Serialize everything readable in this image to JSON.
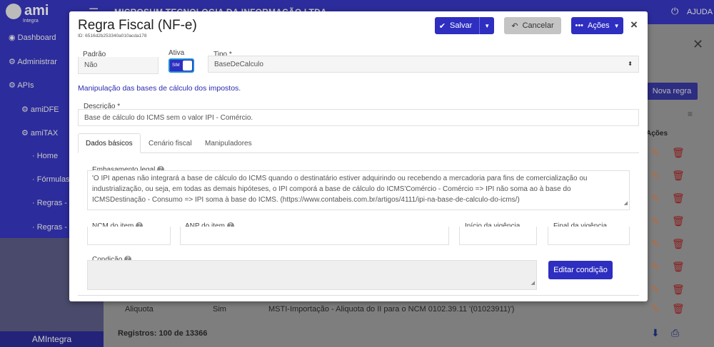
{
  "app": {
    "company": "MICROSUM TECNOLOGIA DA INFORMAÇÃO LTDA",
    "logo_text": "ami",
    "logo_sub": "Integra",
    "help_label": "AJUDA",
    "icons": {
      "menu": "hamburger-icon",
      "power": "power-icon"
    }
  },
  "sidebar": {
    "items": [
      {
        "label": "Dashboard"
      },
      {
        "label": "Administrar"
      },
      {
        "label": "APIs"
      },
      {
        "label": "amiDFE"
      },
      {
        "label": "amiTAX"
      },
      {
        "label": "Home"
      },
      {
        "label": "Fórmulas"
      },
      {
        "label": "Regras -"
      },
      {
        "label": "Regras -"
      }
    ],
    "footer": "AMIntegra"
  },
  "background": {
    "new_rule_button": "Nova regra",
    "actions_header": "Ações",
    "row": {
      "col1": "Aliquota",
      "col2": "Sim",
      "col3": "MSTI-Importação - Aliquota do II para o NCM 0102.39.11 '(01023911)')"
    },
    "records": "Registros: 100 de 13366"
  },
  "modal": {
    "title": "Regra Fiscal (NF-e)",
    "id": "ID: 6516d2b253340a010acda178",
    "buttons": {
      "save": "Salvar",
      "cancel": "Cancelar",
      "actions": "Ações",
      "close": "×",
      "edit_condition": "Editar condição"
    },
    "fields": {
      "padrao_label": "Padrão",
      "padrao_value": "Não",
      "ativa_label": "Ativa",
      "ativa_toggle_text": "SIM",
      "ativa_value": true,
      "tipo_label": "Tipo *",
      "tipo_value": "BaseDeCalculo",
      "manipulation_text": "Manipulação das bases de cálculo dos impostos.",
      "descricao_label": "Descrição *",
      "descricao_value": "Base de cálculo do ICMS sem o valor IPI - Comércio."
    },
    "tabs": [
      {
        "label": "Dados básicos",
        "active": true
      },
      {
        "label": "Cenário fiscal",
        "active": false
      },
      {
        "label": "Manipuladores",
        "active": false
      }
    ],
    "basic": {
      "embasamento_label": "Embasamento legal",
      "embasamento_line1": "'O IPI apenas não integrará a base de cálculo do ICMS quando o destinatário estiver adquirindo ou recebendo a mercadoria para fins de comercialização ou",
      "embasamento_line2": "industrialização, ou seja, em todas as demais hipóteses, o IPI comporá a base de cálculo do ICMS'Comércio    - Comércio  => IPI não soma ao à base do",
      "embasamento_line3": "ICMSDestinação - Consumo    => IPI soma à base do ICMS. (https://www.contabeis.com.br/artigos/4111/ipi-na-base-de-calculo-do-icms/)",
      "ncm_label": "NCM do item",
      "anp_label": "ANP do item",
      "inicio_label": "Início da vigência",
      "final_label": "Final da vigência",
      "condicao_label": "Condição"
    }
  }
}
